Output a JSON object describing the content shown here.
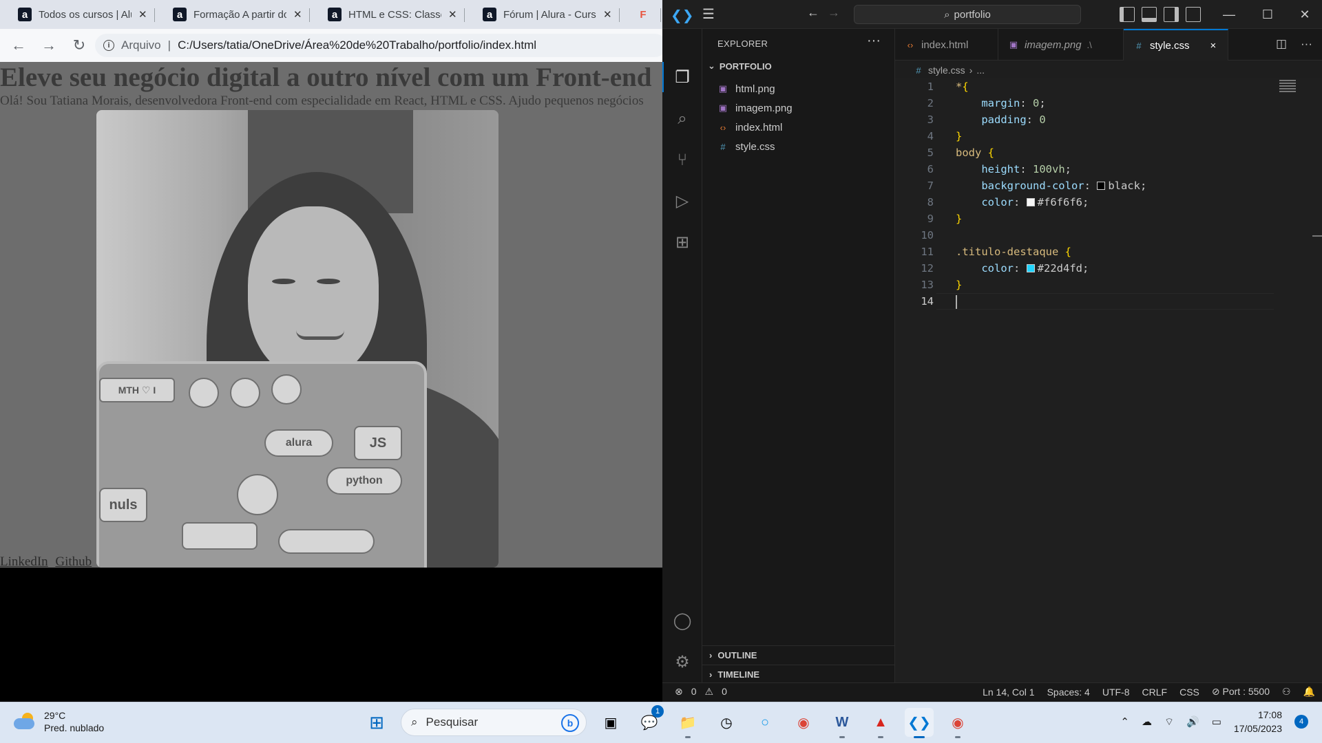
{
  "browser": {
    "tabs": [
      {
        "favicon": "a",
        "title": "Todos os cursos | Alura"
      },
      {
        "favicon": "a",
        "title": "Formação A partir do"
      },
      {
        "favicon": "a",
        "title": "HTML e CSS: Classes,"
      },
      {
        "favicon": "a",
        "title": "Fórum | Alura - Curso"
      },
      {
        "favicon": "F",
        "title": "F"
      }
    ],
    "address_label": "Arquivo",
    "address_separator": "|",
    "url": "C:/Users/tatia/OneDrive/Área%20de%20Trabalho/portfolio/index.html",
    "page": {
      "heading": "Eleve seu negócio digital a outro nível com um Front-end",
      "paragraph": "Olá! Sou Tatiana Morais, desenvolvedora Front-end com especialidade em React, HTML e CSS. Ajudo pequenos negócios",
      "links": [
        "LinkedIn",
        "Github"
      ],
      "laptop_stickers": [
        "JS",
        "alura",
        "python",
        "nuls",
        "MTH ♡ I"
      ]
    }
  },
  "vscode": {
    "search_text": "portfolio",
    "explorer_title": "EXPLORER",
    "section_title": "PORTFOLIO",
    "files": [
      {
        "name": "html.png",
        "type": "img"
      },
      {
        "name": "imagem.png",
        "type": "img"
      },
      {
        "name": "index.html",
        "type": "html"
      },
      {
        "name": "style.css",
        "type": "css"
      }
    ],
    "outline_label": "OUTLINE",
    "timeline_label": "TIMELINE",
    "editor_tabs": [
      {
        "name": "index.html",
        "icon": "html",
        "desc": ""
      },
      {
        "name": "imagem.png",
        "icon": "img",
        "desc": ".\\"
      },
      {
        "name": "style.css",
        "icon": "css",
        "desc": ""
      }
    ],
    "active_tab_close": "×",
    "breadcrumb": {
      "file": "style.css",
      "rest": "..."
    },
    "code_lines": [
      {
        "n": "1",
        "parts": [
          [
            "sel",
            "*"
          ],
          [
            "brace",
            "{"
          ]
        ]
      },
      {
        "n": "2",
        "parts": [
          [
            "plain",
            "    "
          ],
          [
            "prop",
            "margin"
          ],
          [
            "plain",
            ": "
          ],
          [
            "num",
            "0"
          ],
          [
            "plain",
            ";"
          ]
        ]
      },
      {
        "n": "3",
        "parts": [
          [
            "plain",
            "    "
          ],
          [
            "prop",
            "padding"
          ],
          [
            "plain",
            ": "
          ],
          [
            "num",
            "0"
          ]
        ]
      },
      {
        "n": "4",
        "parts": [
          [
            "brace",
            "}"
          ]
        ]
      },
      {
        "n": "5",
        "parts": [
          [
            "sel",
            "body "
          ],
          [
            "brace",
            "{"
          ]
        ]
      },
      {
        "n": "6",
        "parts": [
          [
            "plain",
            "    "
          ],
          [
            "prop",
            "height"
          ],
          [
            "plain",
            ": "
          ],
          [
            "num",
            "100vh"
          ],
          [
            "plain",
            ";"
          ]
        ]
      },
      {
        "n": "7",
        "parts": [
          [
            "plain",
            "    "
          ],
          [
            "prop",
            "background-color"
          ],
          [
            "plain",
            ": "
          ],
          [
            "swatch",
            "#000000"
          ],
          [
            "plain",
            "black;"
          ]
        ]
      },
      {
        "n": "8",
        "parts": [
          [
            "plain",
            "    "
          ],
          [
            "prop",
            "color"
          ],
          [
            "plain",
            ": "
          ],
          [
            "swatch",
            "#f6f6f6"
          ],
          [
            "plain",
            "#f6f6f6;"
          ]
        ]
      },
      {
        "n": "9",
        "parts": [
          [
            "brace",
            "}"
          ]
        ]
      },
      {
        "n": "10",
        "parts": []
      },
      {
        "n": "11",
        "parts": [
          [
            "sel",
            ".titulo-destaque "
          ],
          [
            "brace",
            "{"
          ]
        ]
      },
      {
        "n": "12",
        "parts": [
          [
            "plain",
            "    "
          ],
          [
            "prop",
            "color"
          ],
          [
            "plain",
            ": "
          ],
          [
            "swatch",
            "#22d4fd"
          ],
          [
            "plain",
            "#22d4fd;"
          ]
        ]
      },
      {
        "n": "13",
        "parts": [
          [
            "brace",
            "}"
          ]
        ]
      },
      {
        "n": "14",
        "parts": [
          [
            "cursor",
            ""
          ]
        ]
      }
    ],
    "status": {
      "errors": "0",
      "warnings": "0",
      "position": "Ln 14, Col 1",
      "spaces": "Spaces: 4",
      "encoding": "UTF-8",
      "eol": "CRLF",
      "language": "CSS",
      "port": "Port : 5500"
    }
  },
  "taskbar": {
    "temperature": "29°C",
    "weather": "Pred. nublado",
    "search_placeholder": "Pesquisar",
    "teams_badge": "1",
    "time": "17:08",
    "date": "17/05/2023",
    "notifications": "4"
  },
  "colors": {
    "accent": "#0078d4",
    "swatch_cyan": "#22d4fd"
  }
}
